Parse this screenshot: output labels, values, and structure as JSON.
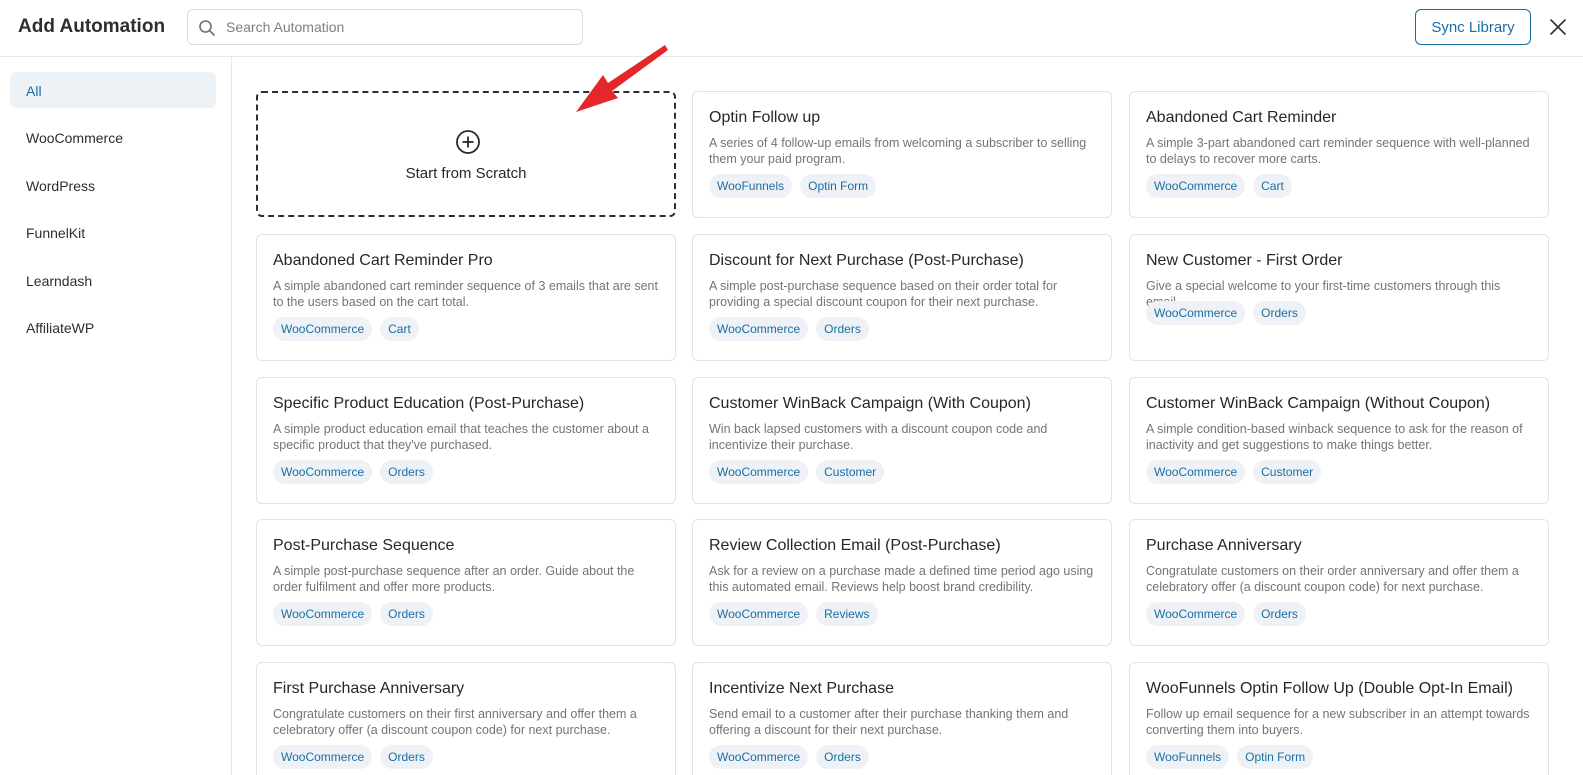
{
  "header": {
    "title": "Add Automation",
    "search_placeholder": "Search Automation",
    "search_value": "",
    "sync_label": "Sync Library"
  },
  "sidebar": {
    "items": [
      {
        "label": "All",
        "active": true
      },
      {
        "label": "WooCommerce"
      },
      {
        "label": "WordPress"
      },
      {
        "label": "FunnelKit"
      },
      {
        "label": "Learndash"
      },
      {
        "label": "AffiliateWP"
      }
    ]
  },
  "scratch": {
    "label": "Start from Scratch"
  },
  "cards": [
    {
      "title": "Optin Follow up",
      "desc": "A series of 4 follow-up emails from welcoming a subscriber to selling them your paid program.",
      "tags": [
        "WooFunnels",
        "Optin Form"
      ]
    },
    {
      "title": "Abandoned Cart Reminder",
      "desc": "A simple 3-part abandoned cart reminder sequence with well-planned to delays to recover more carts.",
      "tags": [
        "WooCommerce",
        "Cart"
      ]
    },
    {
      "title": "Abandoned Cart Reminder Pro",
      "desc": "A simple abandoned cart reminder sequence of 3 emails that are sent to the users based on the cart total.",
      "tags": [
        "WooCommerce",
        "Cart"
      ]
    },
    {
      "title": "Discount for Next Purchase (Post-Purchase)",
      "desc": "A simple post-purchase sequence based on their order total for providing a special discount coupon for their next purchase.",
      "tags": [
        "WooCommerce",
        "Orders"
      ]
    },
    {
      "title": "New Customer - First Order",
      "desc": "Give a special welcome to your first-time customers through this email.",
      "tags": [
        "WooCommerce",
        "Orders"
      ],
      "short": true
    },
    {
      "title": "Specific Product Education (Post-Purchase)",
      "desc": "A simple product education email that teaches the customer about a specific product that they've purchased.",
      "tags": [
        "WooCommerce",
        "Orders"
      ]
    },
    {
      "title": "Customer WinBack Campaign (With Coupon)",
      "desc": "Win back lapsed customers with a discount coupon code and incentivize their purchase.",
      "tags": [
        "WooCommerce",
        "Customer"
      ]
    },
    {
      "title": "Customer WinBack Campaign (Without Coupon)",
      "desc": "A simple condition-based winback sequence to ask for the reason of inactivity and get suggestions to make things better.",
      "tags": [
        "WooCommerce",
        "Customer"
      ]
    },
    {
      "title": "Post-Purchase Sequence",
      "desc": "A simple post-purchase sequence after an order. Guide about the order fulfilment and offer more products.",
      "tags": [
        "WooCommerce",
        "Orders"
      ]
    },
    {
      "title": "Review Collection Email (Post-Purchase)",
      "desc": "Ask for a review on a purchase made a defined time period ago using this automated email. Reviews help boost brand credibility.",
      "tags": [
        "WooCommerce",
        "Reviews"
      ]
    },
    {
      "title": "Purchase Anniversary",
      "desc": "Congratulate customers on their order anniversary and offer them a celebratory offer (a discount coupon code) for next purchase.",
      "tags": [
        "WooCommerce",
        "Orders"
      ]
    },
    {
      "title": "First Purchase Anniversary",
      "desc": "Congratulate customers on their first anniversary and offer them a celebratory offer (a discount coupon code) for next purchase.",
      "tags": [
        "WooCommerce",
        "Orders"
      ]
    },
    {
      "title": "Incentivize Next Purchase",
      "desc": "Send email to a customer after their purchase thanking them and offering a discount for their next purchase.",
      "tags": [
        "WooCommerce",
        "Orders"
      ]
    },
    {
      "title": "WooFunnels Optin Follow Up (Double Opt-In Email)",
      "desc": "Follow up email sequence for a new subscriber in an attempt towards converting them into buyers.",
      "tags": [
        "WooFunnels",
        "Optin Form"
      ]
    }
  ],
  "colors": {
    "accent": "#1a6ea3",
    "annotation_arrow": "#e5262b",
    "tag_bg": "#eef2f6",
    "active_bg": "#edf2f7"
  },
  "icons": {
    "search": "search-icon",
    "close": "close-icon",
    "scratch": "plus-circle-icon",
    "annotation": "red-arrow-icon"
  }
}
